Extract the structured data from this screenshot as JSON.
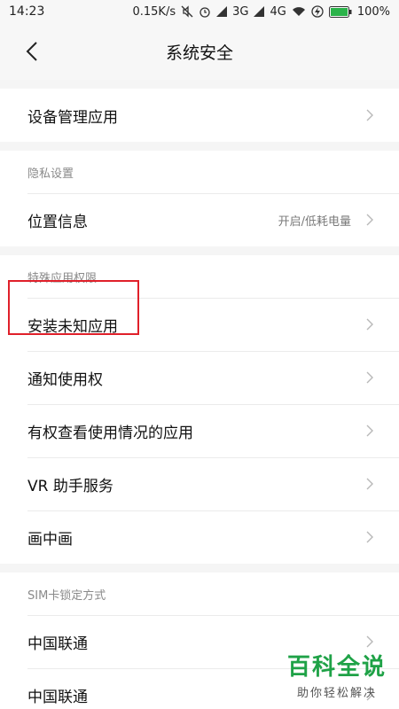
{
  "status": {
    "time": "14:23",
    "speed": "0.15K/s",
    "net1": "3G",
    "net2": "4G",
    "battery": "100%"
  },
  "header": {
    "title": "系统安全"
  },
  "groups": [
    {
      "items": [
        {
          "label": "设备管理应用"
        }
      ]
    },
    {
      "section": "隐私设置",
      "items": [
        {
          "label": "位置信息",
          "value": "开启/低耗电量"
        }
      ]
    },
    {
      "section": "特殊应用权限",
      "items": [
        {
          "label": "安装未知应用"
        },
        {
          "label": "通知使用权"
        },
        {
          "label": "有权查看使用情况的应用"
        },
        {
          "label": "VR 助手服务"
        },
        {
          "label": "画中画"
        }
      ]
    },
    {
      "section": "SIM卡锁定方式",
      "items": [
        {
          "label": "中国联通"
        },
        {
          "label": "中国联通"
        }
      ]
    }
  ],
  "watermark": {
    "main": "百科全说",
    "sub": "助你轻松解决"
  },
  "colors": {
    "highlight": "#e0202a",
    "watermark": "#1fa247"
  }
}
